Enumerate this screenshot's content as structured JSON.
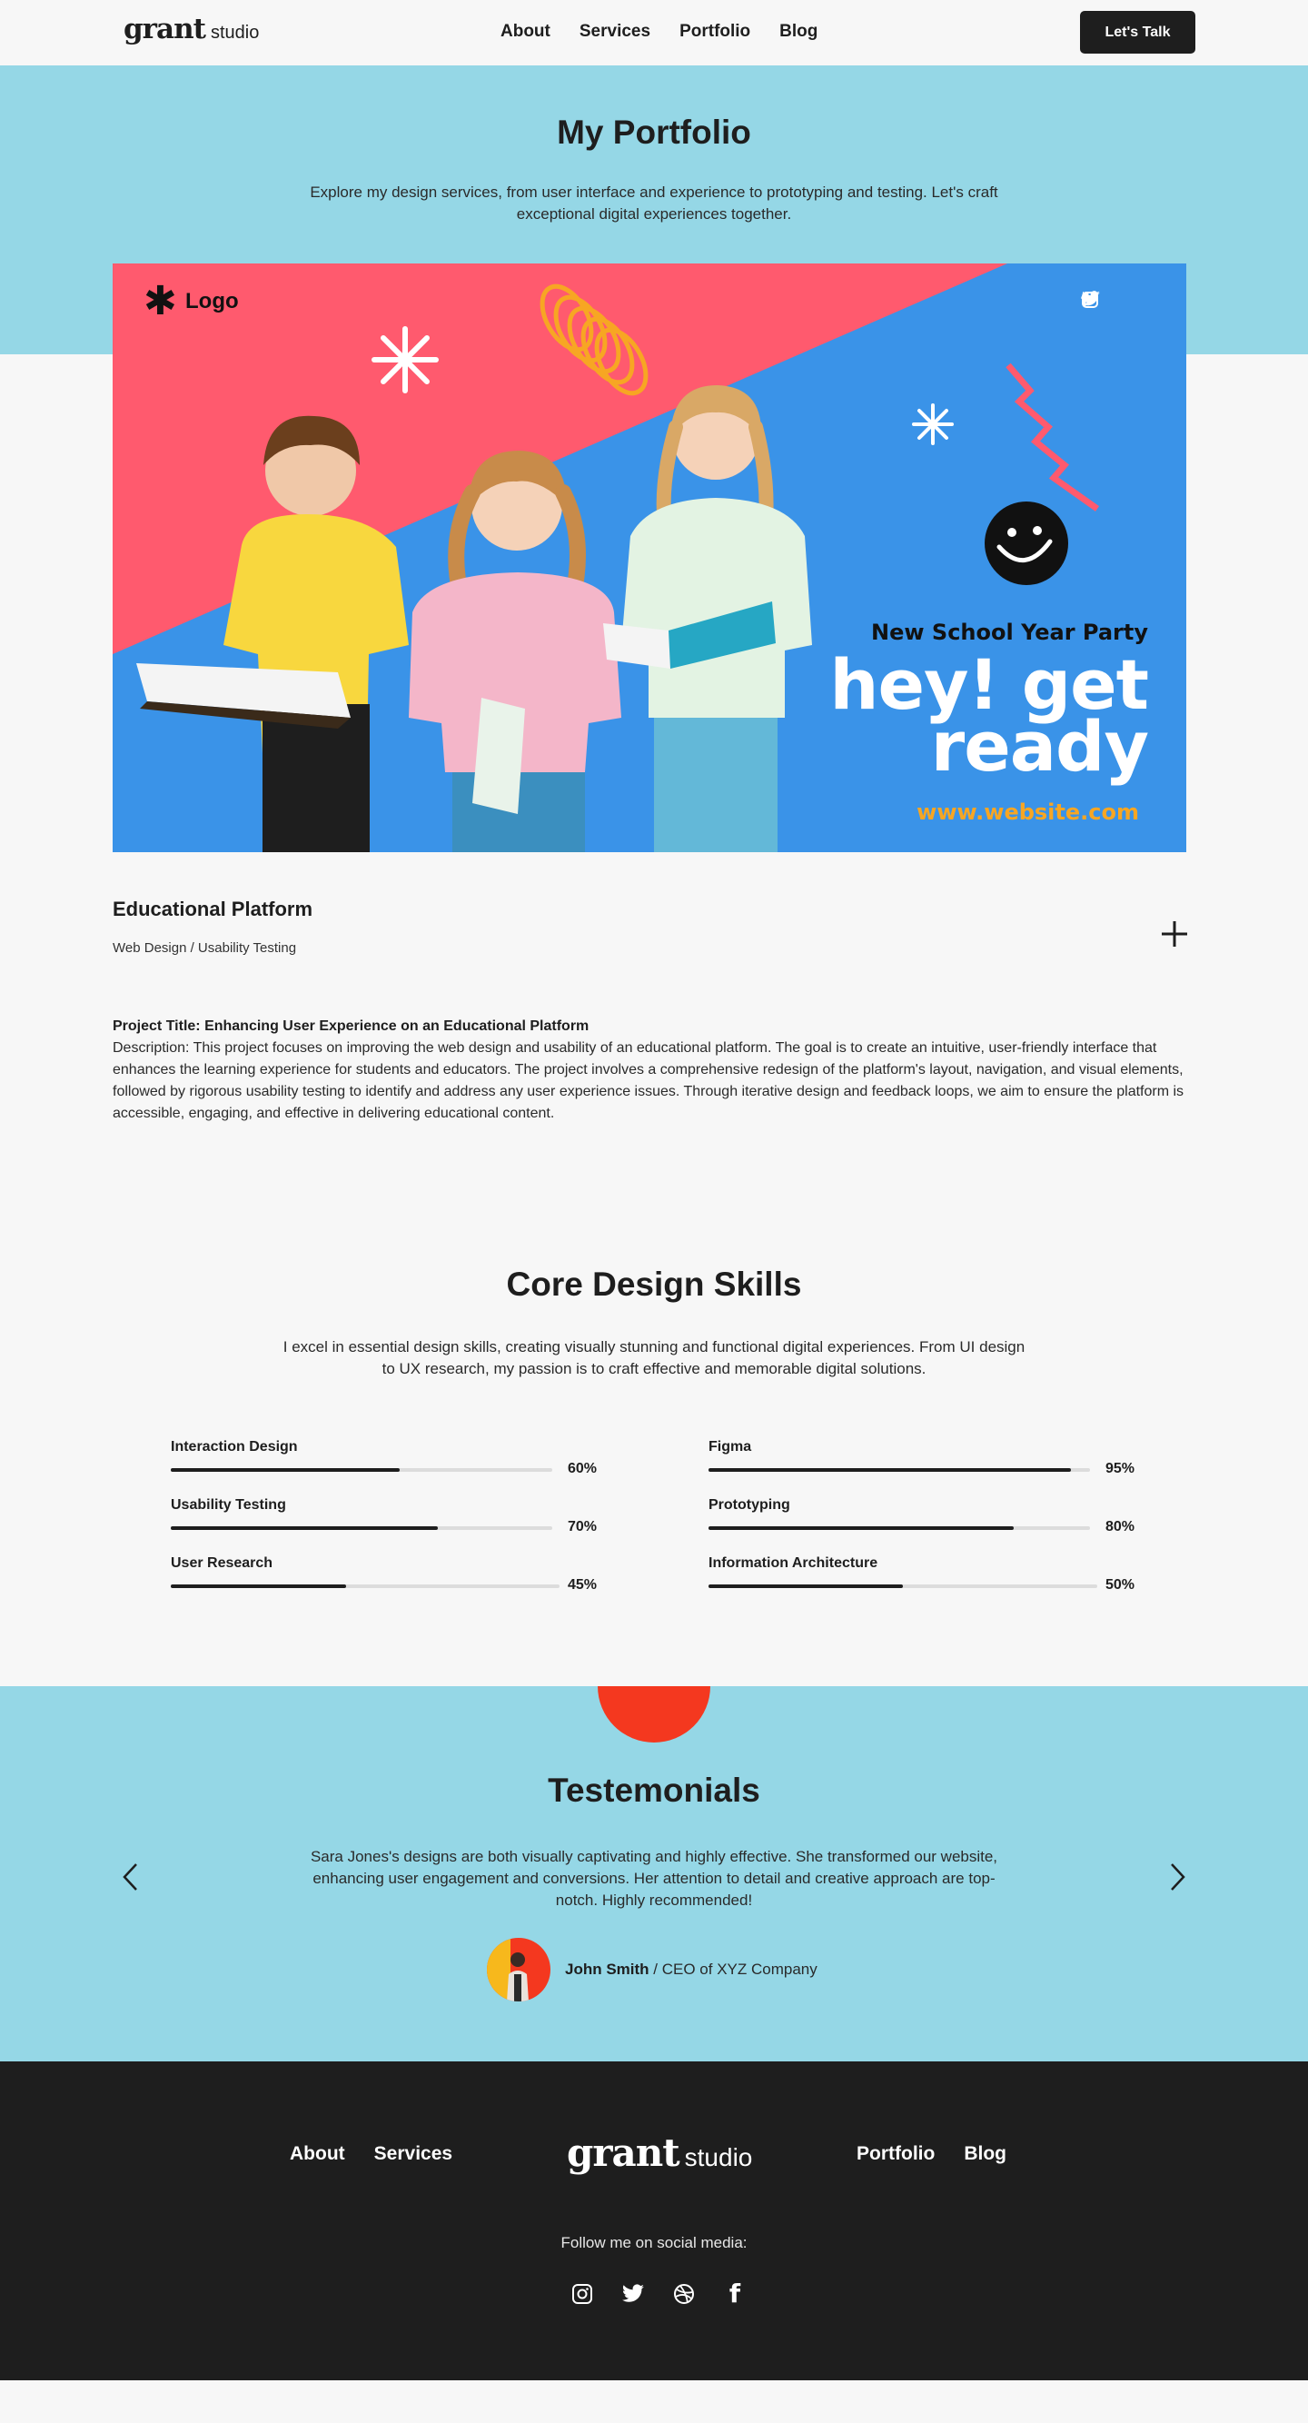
{
  "header": {
    "brand_word": "grant",
    "brand_sub": "studio",
    "nav": [
      "About",
      "Services",
      "Portfolio",
      "Blog"
    ],
    "cta_label": "Let's Talk"
  },
  "hero": {
    "title": "My Portfolio",
    "description": "Explore my design services, from user interface and experience to prototyping and testing. Let's craft exceptional digital experiences together."
  },
  "banner": {
    "logo_text": "Logo",
    "headline_small": "New School Year Party",
    "headline_big_1": "hey! get",
    "headline_big_2": "ready",
    "website": "www.website.com",
    "colors": {
      "red": "#ff5a6e",
      "blue": "#3a93e8",
      "orange": "#f7a623"
    }
  },
  "project": {
    "title": "Educational Platform",
    "tags": "Web Design / Usability Testing",
    "heading": "Project Title: Enhancing User Experience on an Educational Platform",
    "description": "Description: This project focuses on improving the web design and usability of an educational platform. The goal is to create an intuitive, user-friendly interface that enhances the learning experience for students and educators. The project involves a comprehensive redesign of the platform's layout, navigation, and visual elements, followed by rigorous usability testing to identify and address any user experience issues. Through iterative design and feedback loops, we aim to ensure the platform is accessible, engaging, and effective in delivering educational content."
  },
  "skills": {
    "title": "Core Design Skills",
    "description": "I excel in essential design skills, creating visually stunning and functional digital experiences. From UI design to UX research, my passion is to craft effective and memorable digital solutions.",
    "items": [
      {
        "name": "Interaction Design",
        "percent_label": "60%",
        "value": 0.6
      },
      {
        "name": "Usability Testing",
        "percent_label": "70%",
        "value": 0.7
      },
      {
        "name": "User Research",
        "percent_label": "45%",
        "value": 0.45
      },
      {
        "name": "Figma",
        "percent_label": "95%",
        "value": 0.95
      },
      {
        "name": "Prototyping",
        "percent_label": "80%",
        "value": 0.8
      },
      {
        "name": "Information Architecture",
        "percent_label": "50%",
        "value": 0.5
      }
    ]
  },
  "testimonials": {
    "title": "Testemonials",
    "quote": "Sara Jones's designs are both visually captivating and highly effective. She transformed our website, enhancing user engagement and conversions. Her attention to detail and creative approach are top-notch. Highly recommended!",
    "author_name": "John Smith",
    "author_role": " / CEO of XYZ Company"
  },
  "footer": {
    "nav_left": [
      "About",
      "Services"
    ],
    "nav_right": [
      "Portfolio",
      "Blog"
    ],
    "brand_word": "grant",
    "brand_sub": "studio",
    "follow_text": "Follow me on social media:",
    "social_icons": [
      "instagram-icon",
      "twitter-icon",
      "dribbble-icon",
      "facebook-icon"
    ]
  }
}
